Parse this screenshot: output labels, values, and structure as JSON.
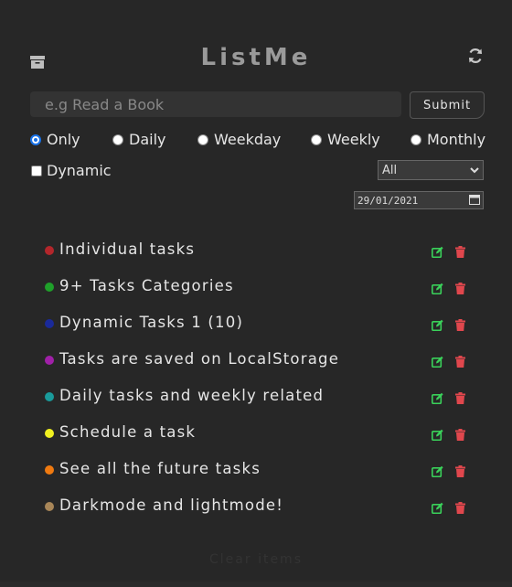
{
  "app": {
    "title": "ListMe",
    "archive_icon": "archive-icon",
    "refresh_icon": "refresh-icon"
  },
  "form": {
    "input_placeholder": "e.g Read a Book",
    "input_value": "",
    "submit_label": "Submit",
    "frequency_options": [
      {
        "label": "Only",
        "checked": true
      },
      {
        "label": "Daily",
        "checked": false
      },
      {
        "label": "Weekday",
        "checked": false
      },
      {
        "label": "Weekly",
        "checked": false
      },
      {
        "label": "Monthly",
        "checked": false
      }
    ],
    "dynamic_label": "Dynamic",
    "dynamic_checked": false,
    "category_value": "All",
    "date_value": "29/01/2021"
  },
  "tasks": [
    {
      "text": "Individual tasks",
      "color": "#b3262b"
    },
    {
      "text": "9+ Tasks Categories",
      "color": "#1fa02a"
    },
    {
      "text": "Dynamic Tasks 1 (10)",
      "color": "#1a2a9a"
    },
    {
      "text": "Tasks are saved on LocalStorage",
      "color": "#a020a8"
    },
    {
      "text": "Daily tasks and weekly related",
      "color": "#1a9b9b"
    },
    {
      "text": "Schedule a task",
      "color": "#f0f020"
    },
    {
      "text": "See all the future tasks",
      "color": "#f07a10"
    },
    {
      "text": "Darkmode and lightmode!",
      "color": "#a88658"
    }
  ],
  "icons": {
    "edit": "edit-icon",
    "delete": "trash-icon",
    "edit_color": "#3ad15a",
    "delete_color": "#e0474d"
  },
  "footer": {
    "label": "Clear items"
  }
}
